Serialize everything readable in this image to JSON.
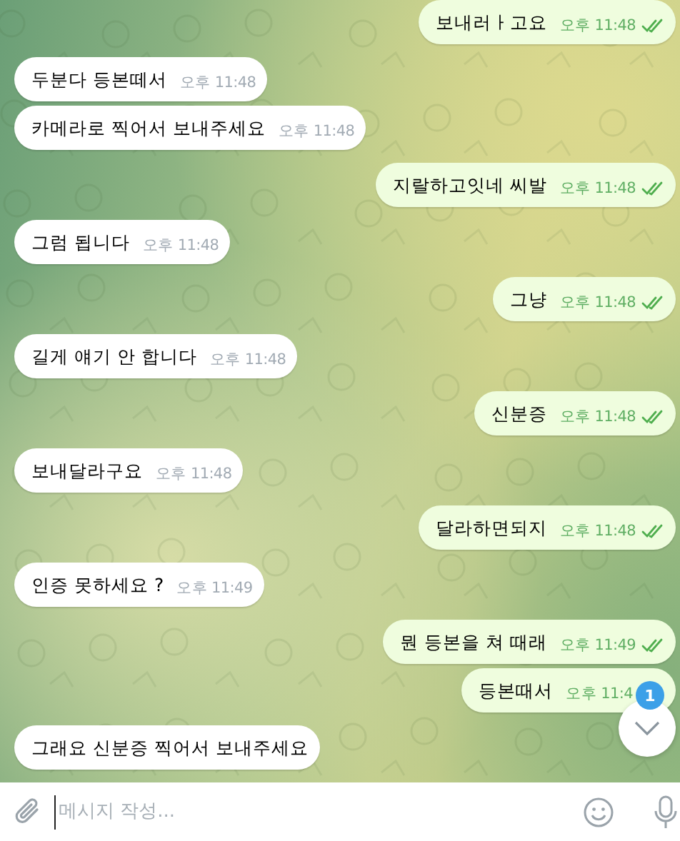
{
  "messages": [
    {
      "kind": "out",
      "text": "보내러ㅏ고요",
      "time": "오후 11:48",
      "read": true
    },
    {
      "kind": "in",
      "text": "두분다 등본떼서",
      "time": "오후 11:48"
    },
    {
      "kind": "in",
      "text": "카메라로 찍어서 보내주세요",
      "time": "오후 11:48"
    },
    {
      "kind": "out",
      "text": "지랄하고잇네 씨발",
      "time": "오후 11:48",
      "read": true
    },
    {
      "kind": "in",
      "text": "그럼 됩니다",
      "time": "오후 11:48"
    },
    {
      "kind": "out",
      "text": "그냥",
      "time": "오후 11:48",
      "read": true
    },
    {
      "kind": "in",
      "text": "길게 얘기 안 합니다",
      "time": "오후 11:48"
    },
    {
      "kind": "out",
      "text": "신분증",
      "time": "오후 11:48",
      "read": true
    },
    {
      "kind": "in",
      "text": "보내달라구요",
      "time": "오후 11:48"
    },
    {
      "kind": "out",
      "text": "달라하면되지",
      "time": "오후 11:48",
      "read": true
    },
    {
      "kind": "in",
      "text": "인증 못하세요 ?",
      "time": "오후 11:49"
    },
    {
      "kind": "out",
      "text": "뭔 등본을 쳐 때래",
      "time": "오후 11:49",
      "read": true
    },
    {
      "kind": "out",
      "text": "등본때서",
      "time": "오후 11:4"
    },
    {
      "kind": "in",
      "text": "그래요 신분증 찍어서 보내주세요"
    }
  ],
  "scroll_button": {
    "badge": "1"
  },
  "composer": {
    "placeholder": "메시지 작성..."
  }
}
